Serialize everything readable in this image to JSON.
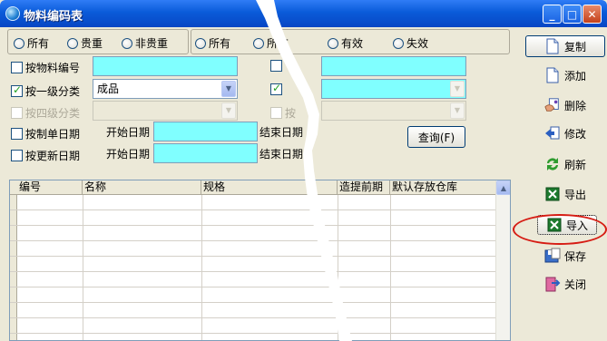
{
  "window": {
    "title": "物料编码表"
  },
  "radio_group_1": {
    "options": [
      "所有",
      "贵重",
      "非贵重"
    ],
    "selected": null
  },
  "radio_group_2": {
    "options": [
      "所有",
      "有效",
      "失效"
    ],
    "partial_hidden_label": "所有",
    "selected": null
  },
  "filters": {
    "by_code": {
      "label": "按物料编号",
      "checked": false,
      "value": ""
    },
    "by_level1": {
      "label": "按一级分类",
      "checked": true,
      "value": "成品"
    },
    "by_level4": {
      "label": "按四级分类",
      "checked": false,
      "disabled": true,
      "value": ""
    },
    "by_create_date": {
      "label": "按制单日期",
      "checked": false,
      "start_label": "开始日期",
      "end_label": "结束日期"
    },
    "by_update_date": {
      "label": "按更新日期",
      "checked": false,
      "start_label": "开始日期",
      "end_label": "结束日期"
    },
    "right_col": {
      "row1_checked": false,
      "row2_checked": true,
      "row3_label_partial": "按",
      "row3_disabled": true
    }
  },
  "query_button": {
    "label": "查询(F)"
  },
  "grid": {
    "columns": [
      "编号",
      "名称",
      "规格",
      "造提前期",
      "默认存放仓库"
    ]
  },
  "side_buttons": [
    {
      "label": "复制",
      "icon": "document-icon"
    },
    {
      "label": "添加",
      "icon": "document-icon"
    },
    {
      "label": "删除",
      "icon": "delete-hand-icon"
    },
    {
      "label": "修改",
      "icon": "edit-arrow-icon"
    },
    {
      "label": "刷新",
      "icon": "refresh-icon"
    },
    {
      "label": "导出",
      "icon": "excel-icon"
    },
    {
      "label": "导入",
      "icon": "excel-icon"
    },
    {
      "label": "保存",
      "icon": "save-icon"
    },
    {
      "label": "关闭",
      "icon": "close-door-icon"
    }
  ],
  "colors": {
    "titlebar": "#0a5bd9",
    "input_highlight": "#80ffff",
    "annotation_ellipse": "#d61c14",
    "window_bg": "#ece9d8"
  }
}
